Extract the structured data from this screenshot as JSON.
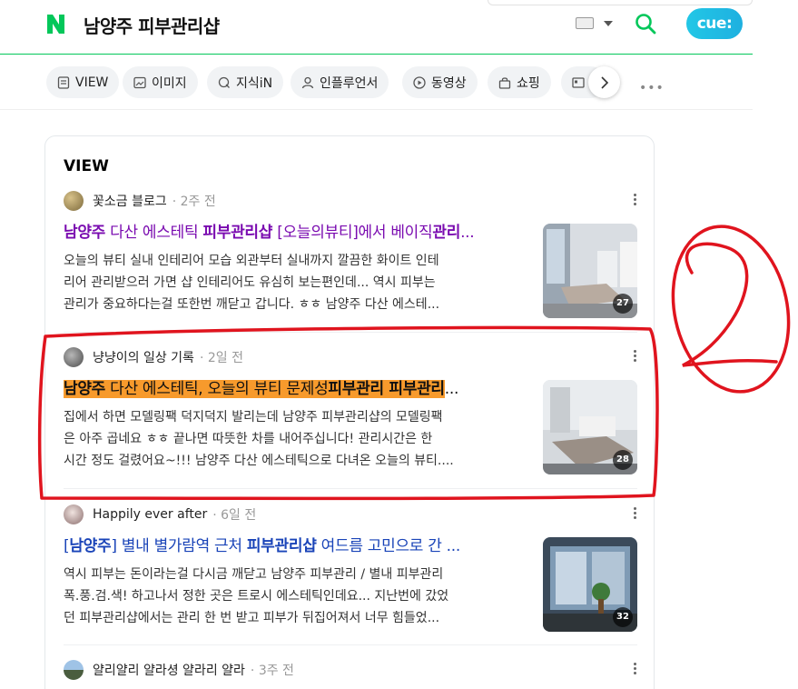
{
  "header": {
    "query": "남양주 피부관리샵",
    "cue_label": "cue:"
  },
  "tabs": [
    {
      "label": "VIEW",
      "icon": "document-icon"
    },
    {
      "label": "이미지",
      "icon": "image-icon"
    },
    {
      "label": "지식iN",
      "icon": "q-icon"
    },
    {
      "label": "인플루언서",
      "icon": "person-icon"
    },
    {
      "label": "동영상",
      "icon": "play-icon"
    },
    {
      "label": "쇼핑",
      "icon": "bag-icon"
    }
  ],
  "section_title": "VIEW",
  "results": [
    {
      "author": "꽃소금 블로그",
      "time": "· 2주 전",
      "title_parts": [
        {
          "t": "남양주",
          "b": true
        },
        {
          "t": " 다산 에스테틱 ",
          "b": false
        },
        {
          "t": "피부관리샵",
          "b": true
        },
        {
          "t": " [오늘의뷰티]에서 베이직",
          "b": false
        },
        {
          "t": "관리",
          "b": true
        },
        {
          "t": "...",
          "b": false
        }
      ],
      "desc_lines": [
        "오늘의 뷰티 실내 인테리어 모습 외관부터 실내까지 깔끔한 화이트 인테",
        "리어 관리받으러 가면 샵 인테리어도 유심히 보는편인데... 역시 피부는",
        "관리가 중요하다는걸 또한번 깨닫고 갑니다. ㅎㅎ 남양주 다산 에스테..."
      ],
      "image_count": "27"
    },
    {
      "author": "냥냥이의 일상 기록",
      "time": "· 2일 전",
      "title_parts": [
        {
          "t": "남양주",
          "b": true
        },
        {
          "t": " 다산 에스테틱, 오늘의 뷰티 문제성",
          "b": false
        },
        {
          "t": "피부관리 피부관리",
          "b": true
        },
        {
          "t": "...",
          "b": false
        }
      ],
      "desc_lines": [
        "집에서 하면 모델링팩 덕지덕지 발리는데 남양주 피부관리샵의 모델링팩",
        "은 아주 곱네요 ㅎㅎ 끝나면 따뜻한 차를 내어주십니다! 관리시간은 한",
        "시간 정도 걸렸어요~!!! 남양주 다산 에스테틱으로 다녀온 오늘의 뷰티...."
      ],
      "image_count": "28"
    },
    {
      "author": "Happily ever after",
      "time": "· 6일 전",
      "title_parts": [
        {
          "t": "[",
          "b": false
        },
        {
          "t": "남양주",
          "b": true
        },
        {
          "t": "] 별내 별가람역 근처 ",
          "b": false
        },
        {
          "t": "피부관리샵",
          "b": true
        },
        {
          "t": " 여드름 고민으로 간 ...",
          "b": false
        }
      ],
      "desc_lines": [
        "역시 피부는 돈이라는걸 다시금 깨닫고 남양주 피부관리 / 별내 피부관리",
        "폭.풍.검.색! 하고나서 정한 곳은 트로시 에스테틱인데요... 지난번에 갔었",
        "던 피부관리샵에서는 관리 한 번 받고 피부가 뒤집어져서 너무 힘들었..."
      ],
      "image_count": "32"
    },
    {
      "author": "얄리얄리 얄라셩 얄라리 얄라",
      "time": "· 3주 전"
    }
  ],
  "annotation_label": "2"
}
